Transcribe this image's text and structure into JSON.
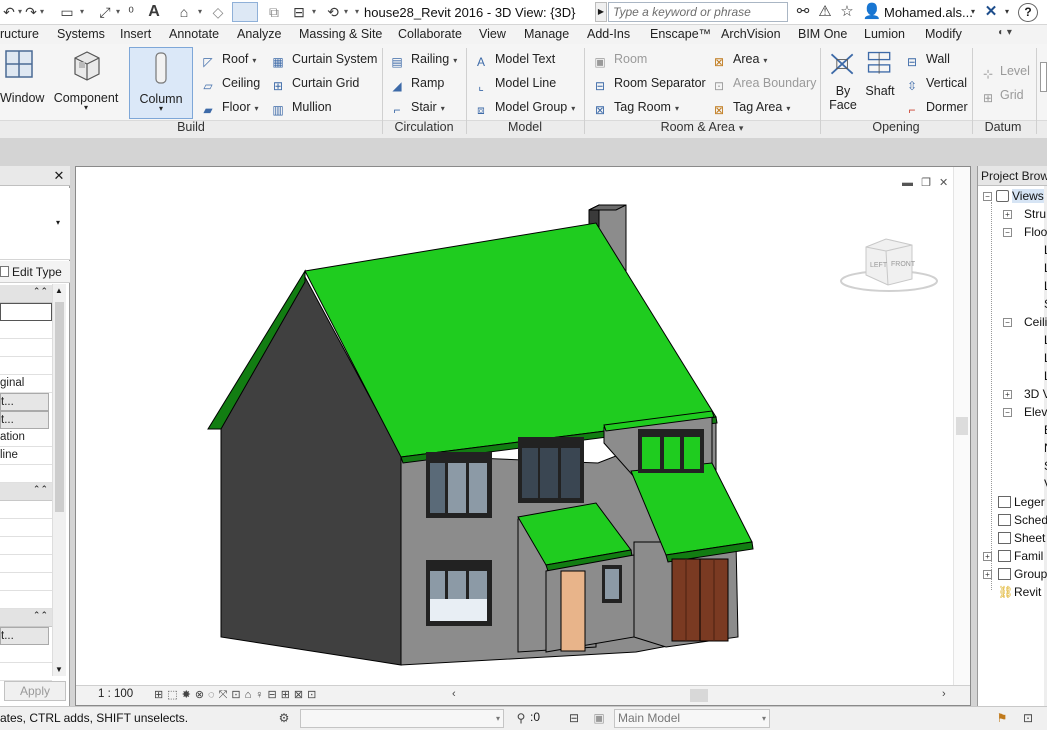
{
  "titlebar": {
    "document_title": "house28_Revit 2016 - 3D View: {3D}",
    "search_placeholder": "Type a keyword or phrase",
    "user_name": "Mohamed.als...",
    "help_label": "?"
  },
  "ribbon_tabs": [
    "ructure",
    "Systems",
    "Insert",
    "Annotate",
    "Analyze",
    "Massing & Site",
    "Collaborate",
    "View",
    "Manage",
    "Add-Ins",
    "Enscape™",
    "ArchVision",
    "BIM One",
    "Lumion",
    "Modify"
  ],
  "ribbon": {
    "build": {
      "window_label": "Window",
      "component_label": "Component",
      "column_label": "Column",
      "roof_label": "Roof",
      "ceiling_label": "Ceiling",
      "floor_label": "Floor",
      "curtain_system_label": "Curtain System",
      "curtain_grid_label": "Curtain Grid",
      "mullion_label": "Mullion",
      "group_label": "Build"
    },
    "circulation": {
      "railing_label": "Railing",
      "ramp_label": "Ramp",
      "stair_label": "Stair",
      "group_label": "Circulation"
    },
    "model": {
      "model_text_label": "Model Text",
      "model_line_label": "Model Line",
      "model_group_label": "Model Group",
      "group_label": "Model"
    },
    "room_area": {
      "room_label": "Room",
      "room_separator_label": "Room Separator",
      "tag_room_label": "Tag Room",
      "area_label": "Area",
      "area_boundary_label": "Area Boundary",
      "tag_area_label": "Tag Area",
      "group_label": "Room & Area"
    },
    "opening": {
      "by_face_label": "By\nFace",
      "by_face_line1": "By",
      "by_face_line2": "Face",
      "shaft_label": "Shaft",
      "wall_label": "Wall",
      "vertical_label": "Vertical",
      "dormer_label": "Dormer",
      "group_label": "Opening"
    },
    "datum": {
      "level_label": "Level",
      "grid_label": "Grid",
      "group_label": "Datum"
    }
  },
  "properties": {
    "edit_type_label": "Edit Type",
    "rows_a": [
      "",
      "",
      "",
      "",
      "ginal",
      "t...",
      "t...",
      "ation",
      "line",
      ""
    ],
    "rows_b": [
      "",
      "",
      "",
      "",
      "",
      "",
      ""
    ],
    "rows_c": [
      "t...",
      "",
      ""
    ],
    "apply_label": "Apply"
  },
  "view": {
    "scale": "1 : 100",
    "viewcube_left": "LEFT",
    "viewcube_front": "FRONT"
  },
  "browser": {
    "title": "Project Browser",
    "items": [
      "Views",
      "Stru",
      "Floo",
      "L",
      "L",
      "L",
      "S",
      "Ceili",
      "L",
      "L",
      "L",
      "3D V",
      "Eleva",
      "E",
      "N",
      "S",
      "V",
      "Leger",
      "Sched",
      "Sheet",
      "Famil",
      "Group",
      "Revit"
    ]
  },
  "status": {
    "hint": "ates, CTRL adds, SHIFT unselects.",
    "filter_count": ":0",
    "model_combo": "Main Model"
  },
  "colors": {
    "roof_green": "#1fcc1f",
    "wall_grey": "#8c8c8c",
    "wall_dark": "#3f3f3f",
    "door_wood": "#e8b48a",
    "garage_wood": "#7a3a22"
  }
}
